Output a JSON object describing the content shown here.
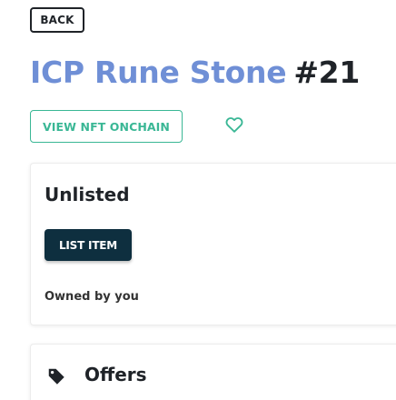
{
  "nav": {
    "back_label": "BACK"
  },
  "nft": {
    "collection_name": "ICP Rune Stone",
    "token_number": "#21",
    "view_onchain_label": "VIEW NFT ONCHAIN",
    "favorite_icon": "heart-outline-icon"
  },
  "listing": {
    "status": "Unlisted",
    "list_button_label": "LIST ITEM",
    "owner_text": "Owned by you"
  },
  "offers": {
    "icon": "tag-icon",
    "title": "Offers"
  },
  "colors": {
    "title_accent": "#6f8fd6",
    "onchain_green": "#3ab795",
    "list_button_bg": "#0e2f3f",
    "text_dark": "#1f2328"
  }
}
